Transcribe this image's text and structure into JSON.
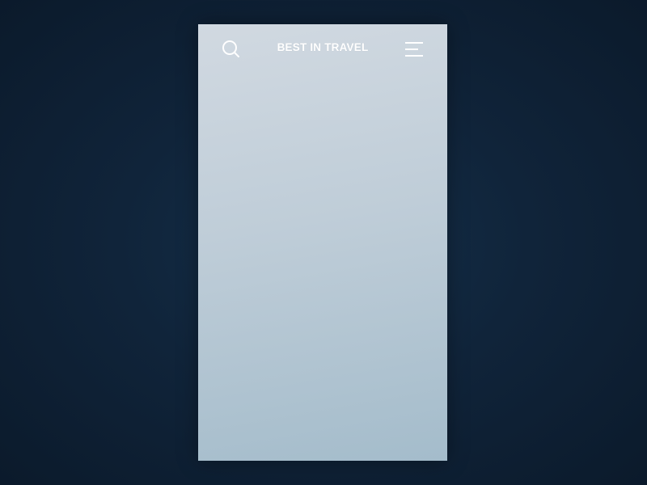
{
  "app": {
    "title": "BEST IN TRAVEL"
  },
  "header": {
    "search_icon": "search-icon",
    "menu_icon": "hamburger-menu-icon"
  },
  "colors": {
    "background": "#10243a",
    "screen_top": "#d1d9e1",
    "screen_bottom": "#a4bccb",
    "header_text": "#ffffff"
  }
}
